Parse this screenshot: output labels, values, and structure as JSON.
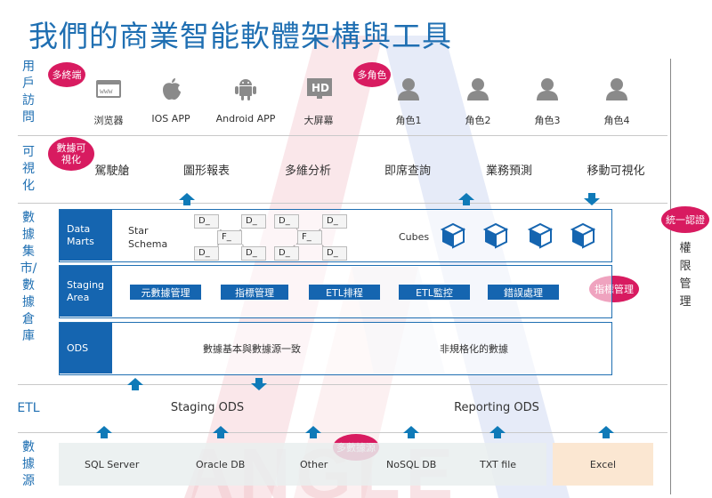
{
  "title": "我們的商業智能軟體架構與工具",
  "watermark": "ANGLE",
  "rows": {
    "users": "用戶訪問",
    "viz": "可視化",
    "dw": "數據集市/數據倉庫",
    "etl": "ETL",
    "sources": "數據源"
  },
  "badges": {
    "multi_terminal": "多終端",
    "multi_role": "多角色",
    "data_viz": "數據可視化",
    "indicator_mgmt": "指標管理",
    "multi_source": "多數據源",
    "unified_auth": "統一認證"
  },
  "side_column": "權限管理",
  "terminals": [
    {
      "label": "浏览器",
      "icon": "browser-icon"
    },
    {
      "label": "IOS APP",
      "icon": "apple-icon"
    },
    {
      "label": "Android APP",
      "icon": "android-icon"
    },
    {
      "label": "大屏幕",
      "icon": "hd-screen-icon"
    }
  ],
  "roles": [
    {
      "label": "角色1",
      "icon": "user-icon"
    },
    {
      "label": "角色2",
      "icon": "user-icon"
    },
    {
      "label": "角色3",
      "icon": "user-icon"
    },
    {
      "label": "角色4",
      "icon": "user-icon"
    }
  ],
  "viz_items": [
    "駕駛艙",
    "圖形報表",
    "多維分析",
    "即席查詢",
    "業務預測",
    "移動可視化"
  ],
  "data_marts": {
    "head": "Data Marts",
    "schema": "Star Schema",
    "d_label": "D_",
    "f_label": "F_",
    "cubes": "Cubes"
  },
  "staging_area": {
    "head": "Staging Area",
    "buttons": [
      "元數據管理",
      "指標管理",
      "ETL排程",
      "ETL監控",
      "錯誤處理"
    ]
  },
  "ods": {
    "head": "ODS",
    "left_text": "數據基本與數據源一致",
    "right_text": "非規格化的數據"
  },
  "etl": {
    "left": "Staging ODS",
    "right": "Reporting ODS"
  },
  "sources": [
    "SQL Server",
    "Oracle DB",
    "Other",
    "NoSQL DB",
    "TXT file"
  ],
  "excel": "Excel",
  "colors": {
    "primary": "#1565b0",
    "accent": "#d81b60",
    "arrow": "#0f7ab8",
    "source_bg": "#e9eeee",
    "excel_bg": "#fbe7d2"
  }
}
